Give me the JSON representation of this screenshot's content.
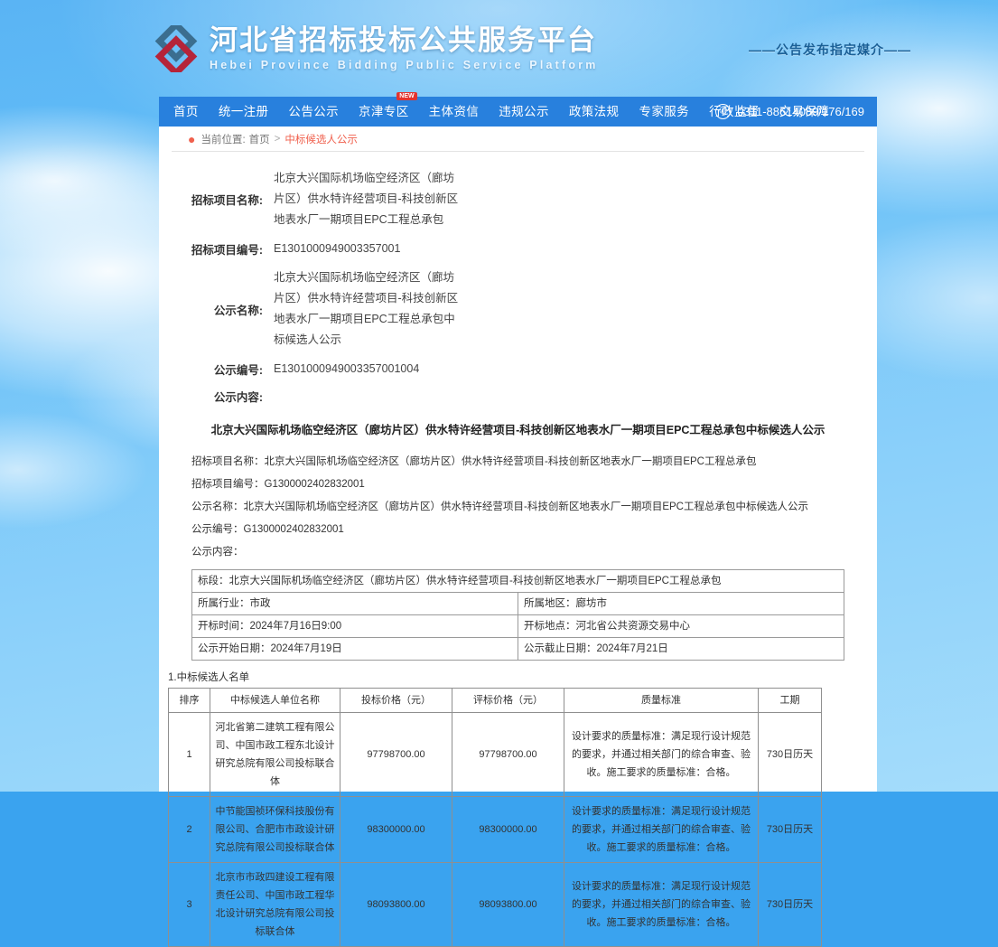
{
  "header": {
    "brand_cn": "河北省招标投标公共服务平台",
    "brand_en": "Hebei  Province  Bidding  Public  Service  Platform",
    "slogan": "——公告发布指定媒介——",
    "logo_icon": "interlocking-diamonds-logo"
  },
  "nav": {
    "items": [
      {
        "label": "首页",
        "badge": ""
      },
      {
        "label": "统一注册",
        "badge": ""
      },
      {
        "label": "公告公示",
        "badge": ""
      },
      {
        "label": "京津专区",
        "badge": "NEW"
      },
      {
        "label": "主体资信",
        "badge": ""
      },
      {
        "label": "违规公示",
        "badge": ""
      },
      {
        "label": "政策法规",
        "badge": ""
      },
      {
        "label": "专家服务",
        "badge": ""
      },
      {
        "label": "行政监督",
        "badge": ""
      },
      {
        "label": "交易保障",
        "badge": ""
      }
    ],
    "phone": "0311-88614089/176/169",
    "phone_icon": "telephone-icon"
  },
  "breadcrumb": {
    "pin_icon": "location-pin-icon",
    "prefix": "当前位置:",
    "home": "首页",
    "separator": ">",
    "current": "中标候选人公示"
  },
  "meta": [
    {
      "label": "招标项目名称:",
      "value": "北京大兴国际机场临空经济区（廊坊片区）供水特许经营项目-科技创新区地表水厂一期项目EPC工程总承包"
    },
    {
      "label": "招标项目编号:",
      "value": "E1301000949003357001"
    },
    {
      "label": "公示名称:",
      "value": "北京大兴国际机场临空经济区（廊坊片区）供水特许经营项目-科技创新区地表水厂一期项目EPC工程总承包中标候选人公示"
    },
    {
      "label": "公示编号:",
      "value": "E1301000949003357001004"
    },
    {
      "label": "公示内容:",
      "value": ""
    }
  ],
  "announcement": {
    "title": "北京大兴国际机场临空经济区（廊坊片区）供水特许经营项目-科技创新区地表水厂一期项目EPC工程总承包中标候选人公示",
    "lines": [
      "招标项目名称：北京大兴国际机场临空经济区（廊坊片区）供水特许经营项目-科技创新区地表水厂一期项目EPC工程总承包",
      "招标项目编号：G1300002402832001",
      "公示名称：北京大兴国际机场临空经济区（廊坊片区）供水特许经营项目-科技创新区地表水厂一期项目EPC工程总承包中标候选人公示",
      "公示编号：G1300002402832001",
      "公示内容："
    ],
    "info_table": {
      "section_label": "标段：北京大兴国际机场临空经济区（廊坊片区）供水特许经营项目-科技创新区地表水厂一期项目EPC工程总承包",
      "rows": [
        {
          "left": "所属行业：市政",
          "right": "所属地区：廊坊市"
        },
        {
          "left": "开标时间：2024年7月16日9:00",
          "right": "开标地点：河北省公共资源交易中心"
        },
        {
          "left": "公示开始日期：2024年7月19日",
          "right": "公示截止日期：2024年7月21日"
        }
      ]
    },
    "list_title": "1.中标候选人名单",
    "candidates_table": {
      "headers": [
        "排序",
        "中标候选人单位名称",
        "投标价格（元）",
        "评标价格（元）",
        "质量标准",
        "工期"
      ],
      "rows": [
        {
          "rank": "1",
          "name": "河北省第二建筑工程有限公司、中国市政工程东北设计研究总院有限公司投标联合体",
          "bid_price": "97798700.00",
          "eval_price": "97798700.00",
          "quality": "设计要求的质量标准：满足现行设计规范的要求，并通过相关部门的综合审查、验收。施工要求的质量标准：合格。",
          "duration": "730日历天"
        },
        {
          "rank": "2",
          "name": "中节能国祯环保科技股份有限公司、合肥市市政设计研究总院有限公司投标联合体",
          "bid_price": "98300000.00",
          "eval_price": "98300000.00",
          "quality": "设计要求的质量标准：满足现行设计规范的要求，并通过相关部门的综合审查、验收。施工要求的质量标准：合格。",
          "duration": "730日历天"
        },
        {
          "rank": "3",
          "name": "北京市市政四建设工程有限责任公司、中国市政工程华北设计研究总院有限公司投标联合体",
          "bid_price": "98093800.00",
          "eval_price": "98093800.00",
          "quality": "设计要求的质量标准：满足现行设计规范的要求，并通过相关部门的综合审查、验收。施工要求的质量标准：合格。",
          "duration": "730日历天"
        }
      ]
    }
  },
  "colors": {
    "nav_blue": "#2880dd",
    "accent_orange": "#f0604d",
    "badge_red": "#e3342f",
    "sky_blue": "#62bdf7"
  }
}
